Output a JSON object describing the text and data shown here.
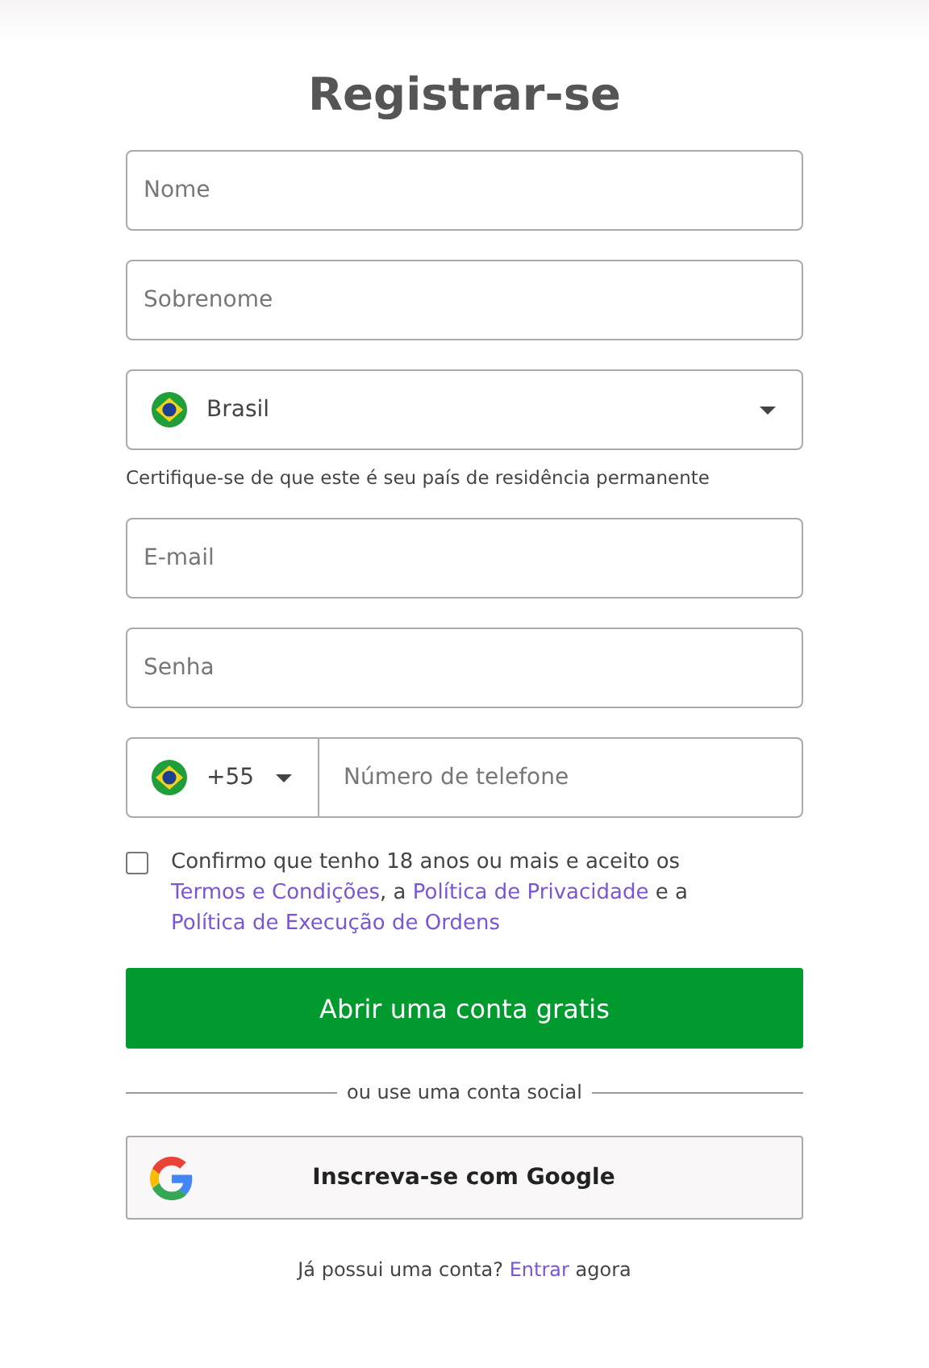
{
  "title": "Registrar-se",
  "fields": [
    {
      "kind": "text",
      "placeholder": "Nome"
    },
    {
      "kind": "text",
      "placeholder": "Sobrenome"
    },
    {
      "kind": "select",
      "value": "Brasil",
      "note": "Certifique-se de que este é seu país de residência permanente"
    },
    {
      "kind": "text",
      "placeholder": "E-mail"
    },
    {
      "kind": "text",
      "placeholder": "Senha"
    },
    {
      "kind": "phone",
      "code": "+55",
      "placeholder": "Número de telefone"
    }
  ],
  "consent": {
    "checked": false,
    "parts": [
      {
        "kind": "text",
        "text": "Confirmo que tenho 18 anos ou mais e aceito os "
      },
      {
        "kind": "link",
        "text": "Termos e Condições"
      },
      {
        "kind": "text",
        "text": ", a "
      },
      {
        "kind": "link",
        "text": "Política de Privacidade"
      },
      {
        "kind": "text",
        "text": " e a "
      },
      {
        "kind": "link",
        "text": "Política de Execução de Ordens"
      }
    ]
  },
  "submit": "Abrir uma conta gratis",
  "divider": "ou use uma conta social",
  "google": "Inscreva-se com Google",
  "login": [
    {
      "kind": "text",
      "text": "Já possui uma conta? "
    },
    {
      "kind": "link",
      "text": "Entrar"
    },
    {
      "kind": "text",
      "text": " agora"
    }
  ]
}
